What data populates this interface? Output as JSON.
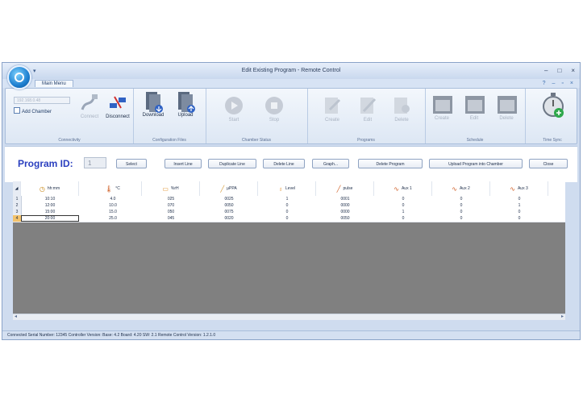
{
  "window": {
    "title": "Edit Existing Program - Remote Control",
    "tab": "Main Menu"
  },
  "ribbon": {
    "combo_placeholder": "192.168.0.48",
    "add_chamber": "Add Chamber",
    "connect": "Connect",
    "disconnect": "Disconnect",
    "download": "Download",
    "upload": "Upload",
    "start": "Start",
    "stop": "Stop",
    "prog_create": "Create",
    "prog_edit": "Edit",
    "prog_delete": "Delete",
    "sched_create": "Create",
    "sched_edit": "Edit",
    "sched_delete": "Delete",
    "time_sync": "Time Sync",
    "groups": {
      "connectivity": "Connectivity",
      "configuration_files": "Configuration Files",
      "chamber_status": "Chamber Status",
      "programs": "Programs",
      "schedule": "Schedule",
      "time_sync": "Time Sync"
    }
  },
  "toolbar": {
    "program_id_label": "Program ID:",
    "program_id_value": "1",
    "select": "Select",
    "insert_line": "Insert Line",
    "duplicate_line": "Duplicate Line",
    "delete_line": "Delete Line",
    "graph": "Graph...",
    "delete_program": "Delete Program",
    "upload_program": "Upload Program into Chamber",
    "close": "Close"
  },
  "table": {
    "columns": [
      "hh:mm",
      "°C",
      "%rH",
      "µPPA",
      "Level",
      "pulse",
      "Aux 1",
      "Aux 2",
      "Aux 3"
    ],
    "rows": [
      {
        "num": "1",
        "cells": [
          "10:10",
          "4.0",
          "025",
          "0025",
          "1",
          "0001",
          "0",
          "0",
          "0"
        ]
      },
      {
        "num": "2",
        "cells": [
          "12:00",
          "10.0",
          "070",
          "0050",
          "0",
          "0000",
          "0",
          "0",
          "1"
        ]
      },
      {
        "num": "3",
        "cells": [
          "15:00",
          "15.0",
          "050",
          "0075",
          "0",
          "0000",
          "1",
          "0",
          "0"
        ]
      },
      {
        "num": "4",
        "cells": [
          "20:00",
          "25.0",
          "045",
          "0020",
          "0",
          "0050",
          "0",
          "0",
          "0"
        ]
      }
    ]
  },
  "status": "Connected   Serial Number: 12345   Controller Version: Base: 4.2 Board: 4.20 SW: 2.1   Remote Control Version: 1.2.1.0",
  "colors": {
    "accent": "#2a3fbf",
    "grid_empty": "#808080"
  }
}
